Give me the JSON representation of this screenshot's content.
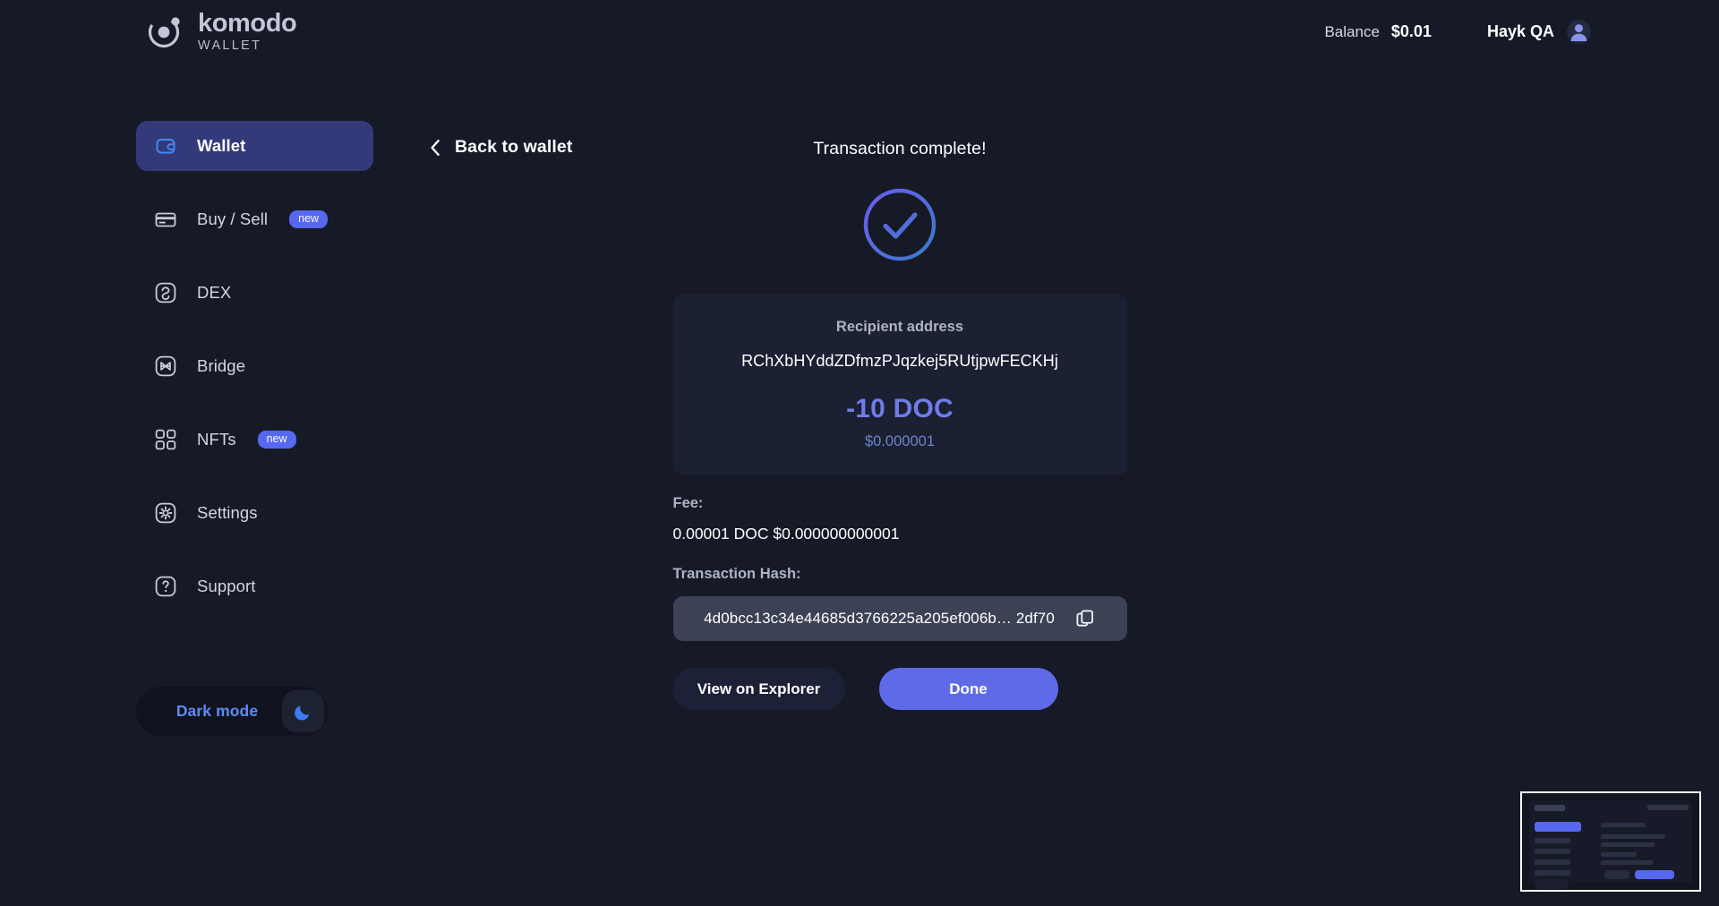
{
  "brand": {
    "name": "komodo",
    "subtitle": "WALLET",
    "logo_icon": "komodo-logo-icon"
  },
  "header": {
    "balance_label": "Balance",
    "balance_value": "$0.01",
    "user_name": "Hayk QA",
    "avatar_icon": "user-avatar-icon"
  },
  "sidebar": {
    "items": [
      {
        "label": "Wallet",
        "icon": "wallet-icon",
        "active": true,
        "badge": ""
      },
      {
        "label": "Buy / Sell",
        "icon": "card-icon",
        "active": false,
        "badge": "new"
      },
      {
        "label": "DEX",
        "icon": "swap-icon",
        "active": false,
        "badge": ""
      },
      {
        "label": "Bridge",
        "icon": "bridge-icon",
        "active": false,
        "badge": ""
      },
      {
        "label": "NFTs",
        "icon": "grid-icon",
        "active": false,
        "badge": "new"
      },
      {
        "label": "Settings",
        "icon": "gear-icon",
        "active": false,
        "badge": ""
      },
      {
        "label": "Support",
        "icon": "question-icon",
        "active": false,
        "badge": ""
      }
    ],
    "theme_toggle": {
      "label": "Dark mode",
      "icon": "moon-icon"
    }
  },
  "main": {
    "back_label": "Back to wallet",
    "back_icon": "chevron-left-icon",
    "title": "Transaction complete!",
    "status_icon": "check-circle-icon",
    "recipient": {
      "label": "Recipient address",
      "address": "RChXbHYddZDfmzPJqzkej5RUtjpwFECKHj",
      "amount": "-10 DOC",
      "amount_fiat": "$0.000001"
    },
    "fee": {
      "label": "Fee:",
      "value": "0.00001 DOC $0.000000000001"
    },
    "hash": {
      "label": "Transaction Hash:",
      "value": "4d0bcc13c34e44685d3766225a205ef006b… 2df70",
      "copy_icon": "copy-icon"
    },
    "buttons": {
      "explorer": "View on Explorer",
      "done": "Done"
    }
  },
  "colors": {
    "page_bg": "#161a27",
    "card_bg": "#1b2032",
    "accent": "#5f6ae8",
    "active_nav": "#343a79",
    "badge": "#5667f0",
    "amount": "#6f7de8",
    "moon": "#3d7bf7",
    "hash_field": "#3c4256"
  }
}
